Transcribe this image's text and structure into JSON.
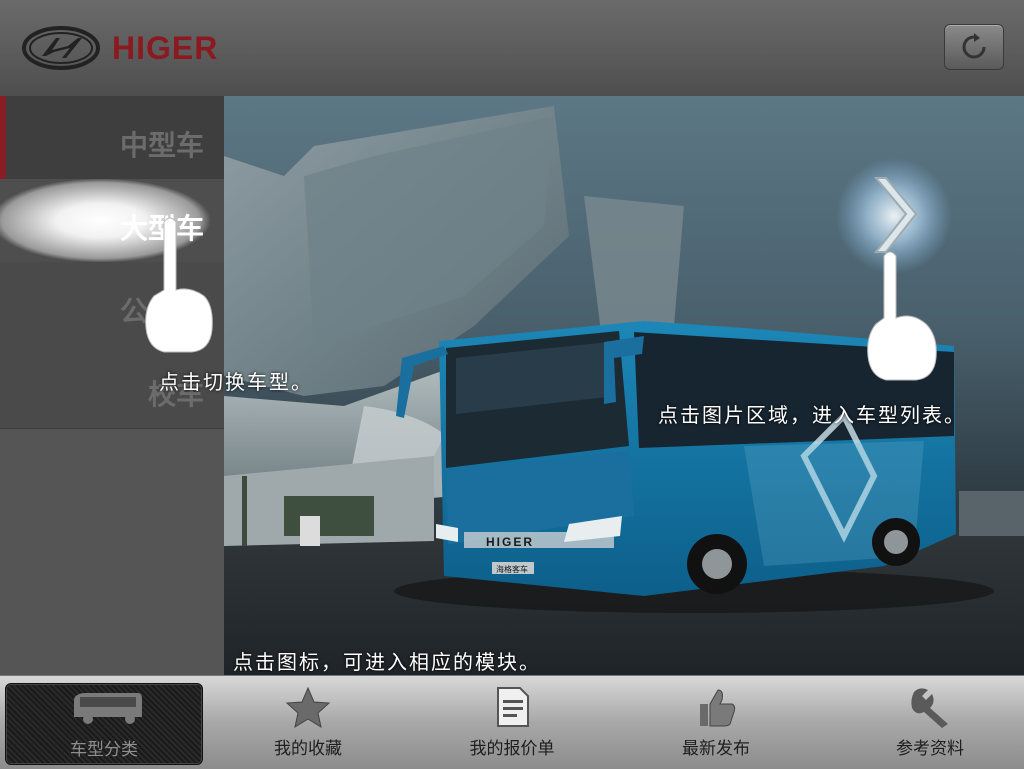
{
  "header": {
    "brand": "HIGER",
    "logo_icon": "higer-emblem-icon",
    "refresh_icon": "refresh-icon",
    "brand_color": "#8b1a20"
  },
  "sidebar": {
    "items": [
      {
        "label": "中型车",
        "state": "current"
      },
      {
        "label": "大型车",
        "state": "highlighted"
      },
      {
        "label": "公交车",
        "state": "normal"
      },
      {
        "label": "校车",
        "state": "normal"
      }
    ]
  },
  "main": {
    "bus_front_text": "HIGER",
    "bus_plate_text": "海格客车",
    "next_icon": "chevron-right-icon"
  },
  "hints": {
    "switch_model": "点击切换车型。",
    "image_area": "点击图片区域，进入车型列表。",
    "icon_module": "点击图标，可进入相应的模块。"
  },
  "tabs": [
    {
      "label": "车型分类",
      "icon": "bus-icon",
      "selected": true
    },
    {
      "label": "我的收藏",
      "icon": "star-icon",
      "selected": false
    },
    {
      "label": "我的报价单",
      "icon": "document-icon",
      "selected": false
    },
    {
      "label": "最新发布",
      "icon": "thumbs-up-icon",
      "selected": false
    },
    {
      "label": "参考资料",
      "icon": "wrench-icon",
      "selected": false
    }
  ]
}
